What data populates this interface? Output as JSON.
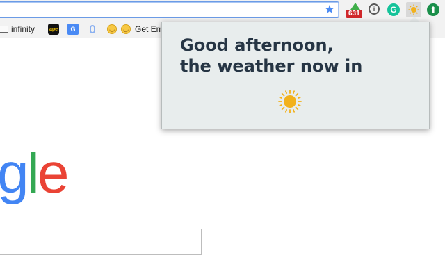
{
  "toolbar": {
    "bookmark_star_icon": "star-icon",
    "extensions": {
      "badge_count": "631",
      "info_glyph": "i",
      "grammarly_glyph": "G",
      "weather_icon": "sun-icon",
      "update_icon": "up-arrow-icon"
    }
  },
  "bookmarks": {
    "items": [
      {
        "icon": "folder-icon",
        "label": "infinity"
      },
      {
        "icon": "ape-icon",
        "label": ""
      },
      {
        "icon": "google-translate-icon",
        "label": ""
      },
      {
        "icon": "microphone-icon",
        "label": ""
      },
      {
        "icon": "smiley-icon",
        "label": ""
      },
      {
        "icon": "smiley-icon",
        "label": "Get Em"
      }
    ]
  },
  "page": {
    "logo_letters": [
      "g",
      "l",
      "e"
    ],
    "logo_colors": [
      "#4285f4",
      "#34a853",
      "#ea4335"
    ]
  },
  "popup": {
    "greeting_line1": "Good afternoon,",
    "greeting_line2": "the weather now in",
    "weather_icon": "sun-icon",
    "sun_color": "#f2b11b"
  }
}
